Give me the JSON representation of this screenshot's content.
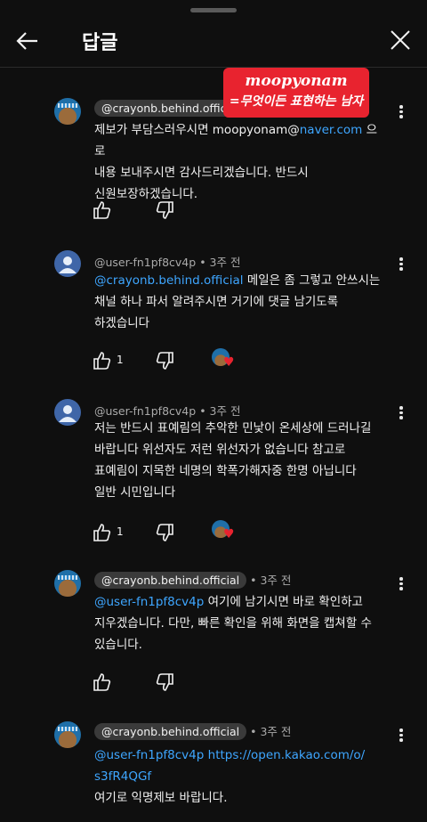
{
  "header": {
    "title": "답글"
  },
  "overlay": {
    "line1": "moopyonam",
    "line2": "=무엇이든 표현하는 남자"
  },
  "comments": [
    {
      "author": "@crayonb.behind.official",
      "time": "",
      "lines": [
        "제보가 부담스러우시면 moopyonam@",
        "naver.com",
        " 으로",
        "내용 보내주시면 감사드리겠습니다. 반드시",
        "신원보장하겠습니다."
      ],
      "likes": ""
    },
    {
      "author": "@user-fn1pf8cv4p",
      "time": "• 3주 전",
      "mention": "@crayonb.behind.official",
      "lines": [
        " 메일은 좀 그렇고 안쓰시는",
        "채널 하나 파서 알려주시면 거기에 댓글 남기도록",
        "하겠습니다"
      ],
      "likes": "1"
    },
    {
      "author": "@user-fn1pf8cv4p",
      "time": "• 3주 전",
      "lines": [
        "저는 반드시 표예림의 추악한 민낯이 온세상에 드러나길",
        "바랍니다 위선자도 저런 위선자가 없습니다 참고로",
        "표예림이 지목한 네명의 학폭가해자중 한명 아닙니다",
        "일반 시민입니다"
      ],
      "likes": "1"
    },
    {
      "author": "@crayonb.behind.official",
      "time": "• 3주 전",
      "mention": "@user-fn1pf8cv4p",
      "lines": [
        " 여기에 남기시면 바로 확인하고",
        "지우겠습니다. 다만, 빠른 확인을 위해 화면을 캡쳐할 수",
        "있습니다."
      ],
      "likes": ""
    },
    {
      "author": "@crayonb.behind.official",
      "time": "• 3주 전",
      "mention": "@user-fn1pf8cv4p",
      "link1": "https://open.kakao.com/o/",
      "link2": "s3fR4QGf",
      "lines": [
        "여기로 익명제보 바랍니다."
      ]
    }
  ]
}
